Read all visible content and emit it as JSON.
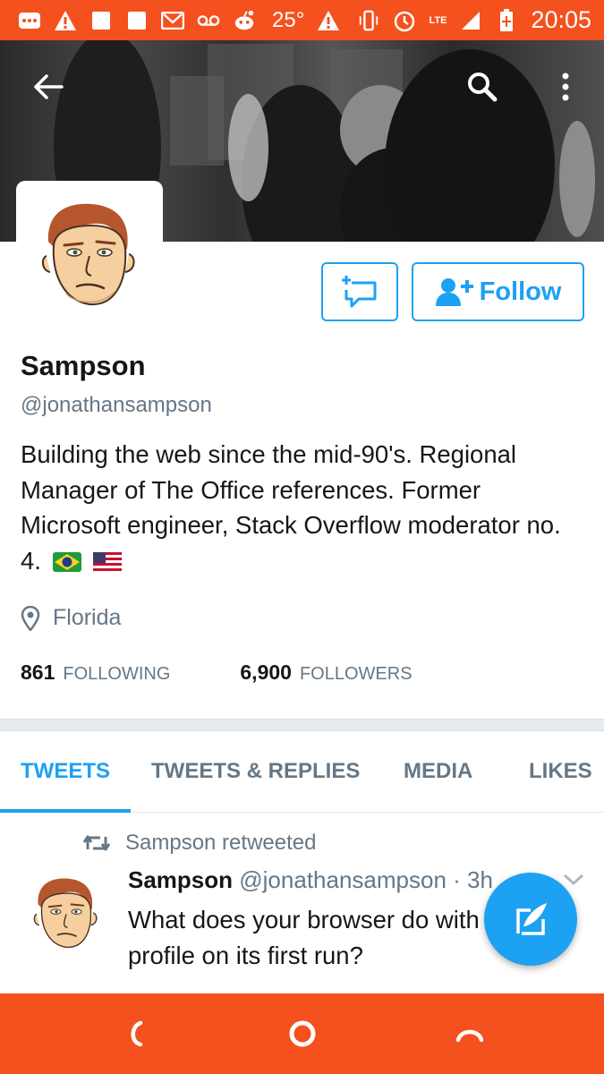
{
  "status_bar": {
    "temperature": "25°",
    "network": "LTE",
    "time": "20:05",
    "icons": [
      "more-notifications-icon",
      "warning-icon",
      "notification-square-icon",
      "notification-square-icon",
      "gmail-icon",
      "voicemail-icon",
      "reddit-icon",
      "warning-icon",
      "vibrate-icon",
      "alarm-icon",
      "signal-icon",
      "battery-icon"
    ]
  },
  "header": {
    "back_icon": "arrow-left-icon",
    "search_icon": "search-icon",
    "menu_icon": "more-vertical-icon"
  },
  "profile": {
    "display_name": "Sampson",
    "handle": "@jonathansampson",
    "bio": "Building the web since the mid-90's. Regional Manager of The Office references. Former Microsoft engineer, Stack Overflow moderator no. 4.",
    "flags": [
      "brazil-flag",
      "usa-flag"
    ],
    "location": "Florida",
    "following_count": "861",
    "following_label": "FOLLOWING",
    "followers_count": "6,900",
    "followers_label": "FOLLOWERS"
  },
  "actions": {
    "follow_label": "Follow"
  },
  "tabs": [
    {
      "label": "TWEETS",
      "active": true
    },
    {
      "label": "TWEETS & REPLIES",
      "active": false
    },
    {
      "label": "MEDIA",
      "active": false
    },
    {
      "label": "LIKES",
      "active": false
    }
  ],
  "tweet": {
    "retweet_label": "Sampson retweeted",
    "author_name": "Sampson",
    "author_handle": "@jonathansampson",
    "time": "· 3h",
    "text": "What does your browser do with a fresh profile on its first run?"
  },
  "colors": {
    "accent": "#1da1f2",
    "system_bar": "#f4511e",
    "muted_text": "#657786",
    "primary_text": "#14171a"
  }
}
